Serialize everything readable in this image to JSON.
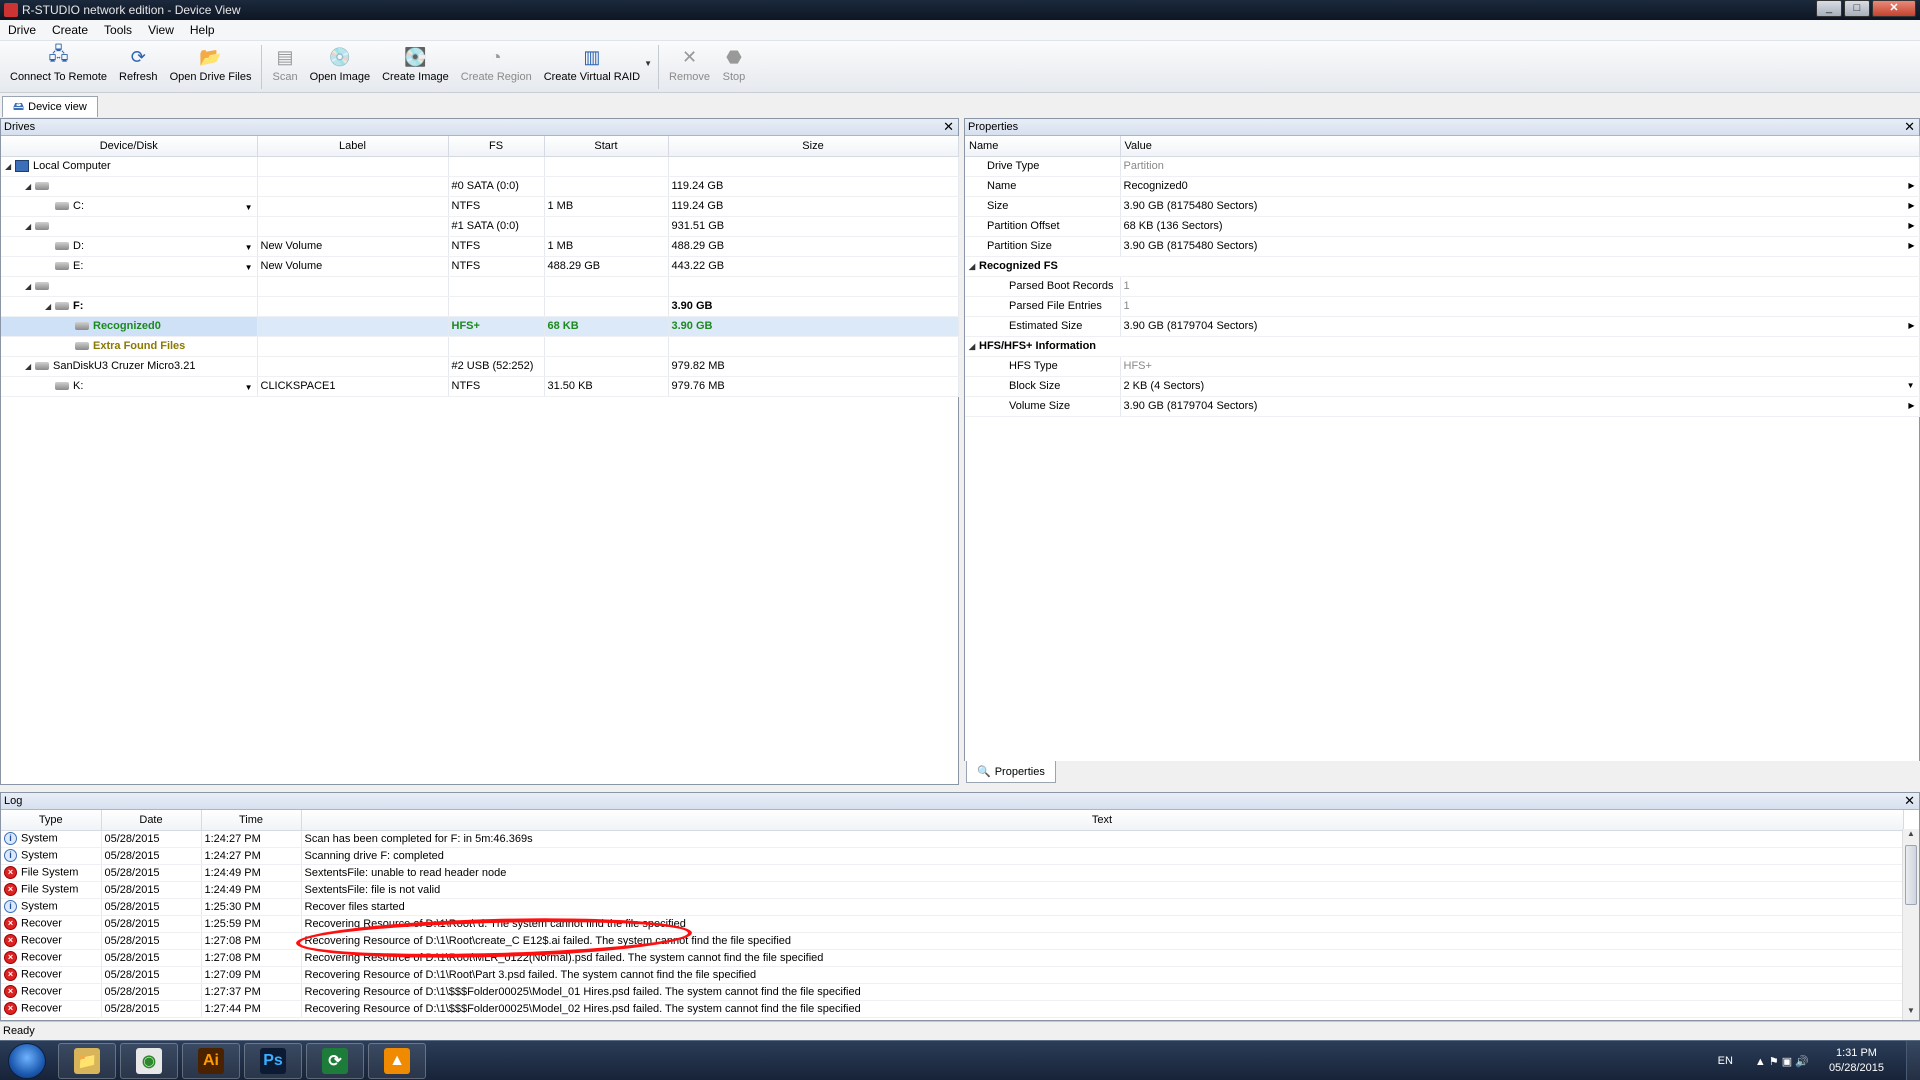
{
  "window": {
    "title": "R-STUDIO network edition - Device View",
    "min": "_",
    "max": "□",
    "close": "✕"
  },
  "menu": [
    "Drive",
    "Create",
    "Tools",
    "View",
    "Help"
  ],
  "toolbar": [
    {
      "label": "Connect To Remote",
      "icon": "connect-remote-icon",
      "glyph": "🖧",
      "disabled": false
    },
    {
      "label": "Refresh",
      "icon": "refresh-icon",
      "glyph": "⟳",
      "disabled": false
    },
    {
      "label": "Open Drive Files",
      "icon": "open-drive-files-icon",
      "glyph": "📂",
      "disabled": false
    },
    {
      "label": "Scan",
      "icon": "scan-icon",
      "glyph": "▤",
      "disabled": true
    },
    {
      "label": "Open Image",
      "icon": "open-image-icon",
      "glyph": "💿",
      "disabled": false
    },
    {
      "label": "Create Image",
      "icon": "create-image-icon",
      "glyph": "💽",
      "disabled": false
    },
    {
      "label": "Create Region",
      "icon": "create-region-icon",
      "glyph": "◔",
      "disabled": true
    },
    {
      "label": "Create Virtual RAID",
      "icon": "create-virtual-raid-icon",
      "glyph": "▥",
      "disabled": false
    },
    {
      "label": "Remove",
      "icon": "remove-icon",
      "glyph": "✕",
      "disabled": true
    },
    {
      "label": "Stop",
      "icon": "stop-icon",
      "glyph": "⬣",
      "disabled": true
    }
  ],
  "view_tab": "Device view",
  "drives": {
    "title": "Drives",
    "close": "✕",
    "columns": [
      "Device/Disk",
      "Label",
      "FS",
      "Start",
      "Size"
    ],
    "rows": [
      {
        "level": 0,
        "tri": "◢",
        "icon": "computer",
        "name": "Local Computer",
        "label": "",
        "fs": "",
        "start": "",
        "size": "",
        "style": ""
      },
      {
        "level": 1,
        "tri": "◢",
        "icon": "disk",
        "name": "",
        "label": "",
        "fs": "#0 SATA (0:0)",
        "start": "",
        "size": "119.24 GB",
        "style": ""
      },
      {
        "level": 2,
        "tri": "",
        "icon": "disk",
        "name": "C:",
        "label": "",
        "fs": "NTFS",
        "start": "1 MB",
        "size": "119.24 GB",
        "style": "",
        "combo": true
      },
      {
        "level": 1,
        "tri": "◢",
        "icon": "disk",
        "name": "",
        "label": "",
        "fs": "#1 SATA (0:0)",
        "start": "",
        "size": "931.51 GB",
        "style": ""
      },
      {
        "level": 2,
        "tri": "",
        "icon": "disk",
        "name": "D:",
        "label": "New Volume",
        "fs": "NTFS",
        "start": "1 MB",
        "size": "488.29 GB",
        "style": "",
        "combo": true
      },
      {
        "level": 2,
        "tri": "",
        "icon": "disk",
        "name": "E:",
        "label": "New Volume",
        "fs": "NTFS",
        "start": "488.29 GB",
        "size": "443.22 GB",
        "style": "",
        "combo": true
      },
      {
        "level": 1,
        "tri": "◢",
        "icon": "disk",
        "name": "",
        "label": "",
        "fs": "",
        "start": "",
        "size": "",
        "style": ""
      },
      {
        "level": 2,
        "tri": "◢",
        "icon": "disk-f",
        "name": "F:",
        "label": "",
        "fs": "",
        "start": "",
        "size": "3.90 GB",
        "style": "bold"
      },
      {
        "level": 3,
        "tri": "",
        "icon": "disk",
        "name": "Recognized0",
        "label": "",
        "fs": "HFS+",
        "start": "68 KB",
        "size": "3.90 GB",
        "style": "green",
        "selected": true
      },
      {
        "level": 3,
        "tri": "",
        "icon": "disk",
        "name": "Extra Found Files",
        "label": "",
        "fs": "",
        "start": "",
        "size": "",
        "style": "olive"
      },
      {
        "level": 1,
        "tri": "◢",
        "icon": "disk",
        "name": "SanDiskU3 Cruzer Micro3.21",
        "label": "",
        "fs": "#2 USB (52:252)",
        "start": "",
        "size": "979.82 MB",
        "style": ""
      },
      {
        "level": 2,
        "tri": "",
        "icon": "disk",
        "name": "K:",
        "label": "CLICKSPACE1",
        "fs": "NTFS",
        "start": "31.50 KB",
        "size": "979.76 MB",
        "style": "",
        "combo": true
      }
    ]
  },
  "properties": {
    "title": "Properties",
    "close": "✕",
    "columns": [
      "Name",
      "Value"
    ],
    "rows": [
      {
        "group": false,
        "name": "Drive Type",
        "value": "Partition",
        "gray": true,
        "arrow": ""
      },
      {
        "group": false,
        "name": "Name",
        "value": "Recognized0",
        "gray": false,
        "arrow": "▶"
      },
      {
        "group": false,
        "name": "Size",
        "value": "3.90 GB (8175480 Sectors)",
        "gray": false,
        "arrow": "▶"
      },
      {
        "group": false,
        "name": "Partition Offset",
        "value": "68 KB (136 Sectors)",
        "gray": false,
        "arrow": "▶"
      },
      {
        "group": false,
        "name": "Partition Size",
        "value": "3.90 GB (8175480 Sectors)",
        "gray": false,
        "arrow": "▶"
      },
      {
        "group": true,
        "name": "Recognized FS",
        "value": "",
        "tri": "◢"
      },
      {
        "group": false,
        "name": "Parsed Boot Records",
        "value": "1",
        "gray": true,
        "arrow": "",
        "indent": true
      },
      {
        "group": false,
        "name": "Parsed File Entries",
        "value": "1",
        "gray": true,
        "arrow": "",
        "indent": true
      },
      {
        "group": false,
        "name": "Estimated Size",
        "value": "3.90 GB (8179704 Sectors)",
        "gray": false,
        "arrow": "▶",
        "indent": true
      },
      {
        "group": true,
        "name": "HFS/HFS+ Information",
        "value": "",
        "tri": "◢"
      },
      {
        "group": false,
        "name": "HFS Type",
        "value": "HFS+",
        "gray": true,
        "arrow": "",
        "indent": true
      },
      {
        "group": false,
        "name": "Block Size",
        "value": "2 KB (4 Sectors)",
        "gray": false,
        "arrow": "▼",
        "indent": true
      },
      {
        "group": false,
        "name": "Volume Size",
        "value": "3.90 GB (8179704 Sectors)",
        "gray": false,
        "arrow": "▶",
        "indent": true
      }
    ],
    "tab": "Properties"
  },
  "log": {
    "title": "Log",
    "close": "✕",
    "columns": [
      "Type",
      "Date",
      "Time",
      "Text"
    ],
    "rows": [
      {
        "kind": "info",
        "type": "System",
        "date": "05/28/2015",
        "time": "1:24:27 PM",
        "text": "Scan has been completed for F: in 5m:46.369s"
      },
      {
        "kind": "info",
        "type": "System",
        "date": "05/28/2015",
        "time": "1:24:27 PM",
        "text": "Scanning drive F: completed"
      },
      {
        "kind": "err",
        "type": "File System",
        "date": "05/28/2015",
        "time": "1:24:49 PM",
        "text": "SextentsFile: unable to read header node"
      },
      {
        "kind": "err",
        "type": "File System",
        "date": "05/28/2015",
        "time": "1:24:49 PM",
        "text": "SextentsFile: file is not valid"
      },
      {
        "kind": "info",
        "type": "System",
        "date": "05/28/2015",
        "time": "1:25:30 PM",
        "text": "Recover files started"
      },
      {
        "kind": "err",
        "type": "Recover",
        "date": "05/28/2015",
        "time": "1:25:59 PM",
        "text": "Recovering Resource of D:\\1\\Root\\                              d. The system cannot find the file specified"
      },
      {
        "kind": "err",
        "type": "Recover",
        "date": "05/28/2015",
        "time": "1:27:08 PM",
        "text": "Recovering Resource of D:\\1\\Root\\create_C                    E12$.ai failed. The system cannot find the file specified"
      },
      {
        "kind": "err",
        "type": "Recover",
        "date": "05/28/2015",
        "time": "1:27:08 PM",
        "text": "Recovering Resource of D:\\1\\Root\\MLR_0122(Normal).psd failed. The system cannot find the file specified"
      },
      {
        "kind": "err",
        "type": "Recover",
        "date": "05/28/2015",
        "time": "1:27:09 PM",
        "text": "Recovering Resource of D:\\1\\Root\\Part 3.psd failed. The system cannot find the file specified"
      },
      {
        "kind": "err",
        "type": "Recover",
        "date": "05/28/2015",
        "time": "1:27:37 PM",
        "text": "Recovering Resource of D:\\1\\$$$Folder00025\\Model_01 Hires.psd failed. The system cannot find the file specified"
      },
      {
        "kind": "err",
        "type": "Recover",
        "date": "05/28/2015",
        "time": "1:27:44 PM",
        "text": "Recovering Resource of D:\\1\\$$$Folder00025\\Model_02 Hires.psd failed. The system cannot find the file specified"
      }
    ]
  },
  "status": "Ready",
  "taskbar": {
    "apps": [
      {
        "name": "explorer",
        "glyph": "📁",
        "bg": "#d8b45a",
        "fg": "#fff"
      },
      {
        "name": "chrome",
        "glyph": "◉",
        "bg": "#e8e8e8",
        "fg": "#2a8a2a"
      },
      {
        "name": "illustrator",
        "glyph": "Ai",
        "bg": "#4a2200",
        "fg": "#ff9a00"
      },
      {
        "name": "photoshop",
        "glyph": "Ps",
        "bg": "#0c1a33",
        "fg": "#3ab0ff"
      },
      {
        "name": "r-studio",
        "glyph": "⟳",
        "bg": "#1e7c3a",
        "fg": "#fff"
      },
      {
        "name": "vlc",
        "glyph": "▲",
        "bg": "#f08a00",
        "fg": "#fff"
      }
    ],
    "lang": "EN",
    "tray_icons": "▲  ⚑  ▣  🔊",
    "time": "1:31 PM",
    "date": "05/28/2015"
  }
}
